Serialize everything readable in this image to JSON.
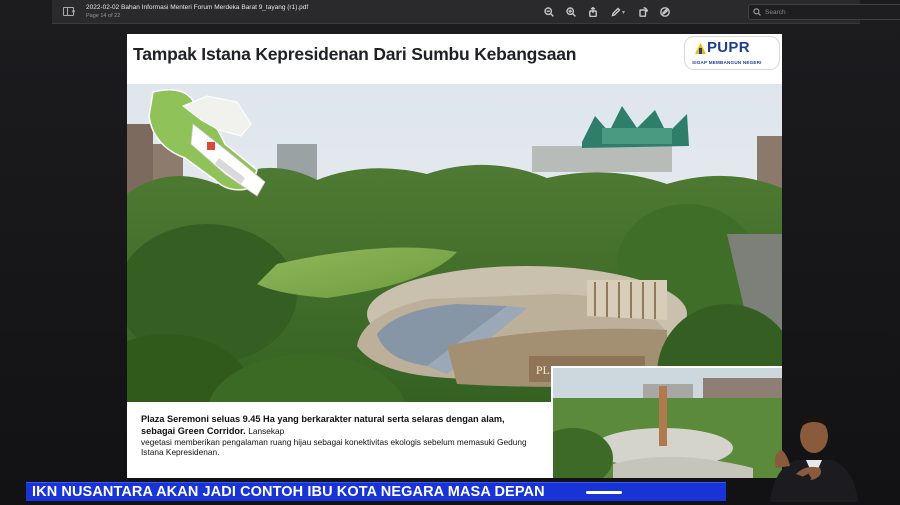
{
  "viewer": {
    "document_title": "2022-02-02 Bahan Informasi Menteri Forum Merdeka Barat 9_tayang (r1).pdf",
    "page_count": "Page 14 of 22",
    "search_placeholder": "Search",
    "tools": [
      "zoom-out-icon",
      "zoom-in-icon",
      "share-icon",
      "markup-pen-icon",
      "rotate-icon",
      "markup-toolbar-icon"
    ]
  },
  "slide": {
    "title": "Tampak Istana Kepresidenan Dari Sumbu Kebangsaan",
    "logo": {
      "name": "PUPR",
      "tagline": "SIGAP MEMBANGUN NEGERI",
      "color": "#1e3d8f",
      "accent": "#f5b800"
    },
    "plaza_sign": "PLAZA SEREMONI",
    "caption": {
      "bold": "Plaza Seremoni seluas 9.45 Ha yang berkarakter natural serta selaras dengan alam, sebagai Green Corridor.",
      "bold_tail": "Lansekap",
      "body": "vegetasi memberikan pengalaman ruang hijau  sebagai konektivitas ekologis sebelum memasuki Gedung Istana Kepresidenan."
    }
  },
  "ticker": {
    "text": "IKN NUSANTARA AKAN JADI CONTOH IBU KOTA NEGARA MASA DEPAN",
    "color": "#1833d6"
  }
}
